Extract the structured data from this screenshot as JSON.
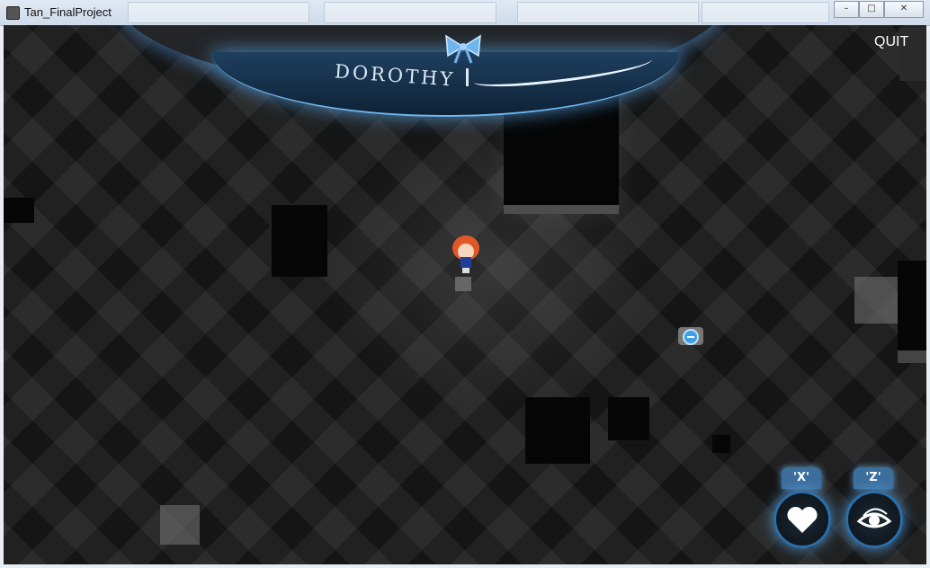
{
  "window": {
    "title": "Tan_FinalProject",
    "icon": "app-icon"
  },
  "hud": {
    "character_name": "DOROTHY",
    "quit_label": "QUIT",
    "bow_icon": "bow-icon",
    "accent_color": "#5aaaf0"
  },
  "actions": [
    {
      "key": "'X'",
      "icon": "heart-icon"
    },
    {
      "key": "'Z'",
      "icon": "eye-icon"
    }
  ],
  "colors": {
    "background": "#151515",
    "glow": "#5aaaf0"
  }
}
